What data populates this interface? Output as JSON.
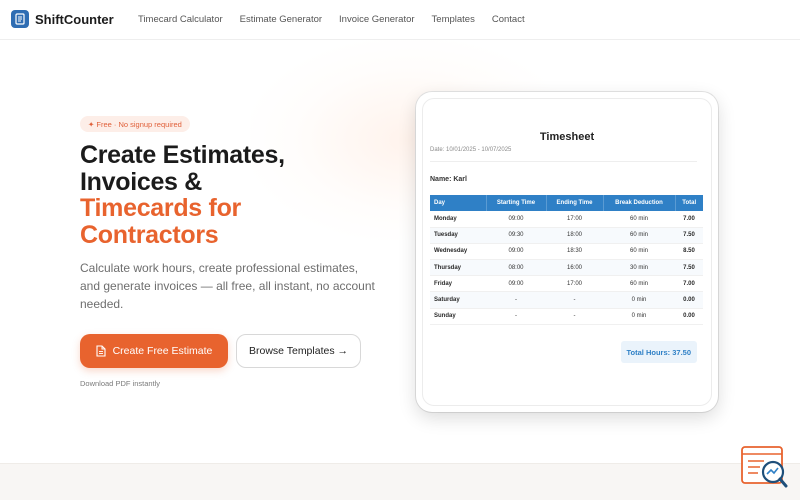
{
  "header": {
    "brand": "ShiftCounter",
    "nav": [
      "Timecard Calculator",
      "Estimate Generator",
      "Invoice Generator",
      "Templates",
      "Contact"
    ]
  },
  "hero": {
    "badge": "✦ Free · No signup required",
    "title_line1": "Create Estimates,",
    "title_line2": "Invoices &",
    "title_accent_line1": "Timecards for",
    "title_accent_line2": "Contractors",
    "subtitle": "Calculate work hours, create professional estimates, and generate invoices — all free, all instant, no account needed.",
    "primary_button": "Create Free Estimate",
    "secondary_button": "Browse Templates →",
    "hint": "Download PDF instantly"
  },
  "timesheet": {
    "title": "Timesheet",
    "date": "Date: 10/01/2025 - 10/07/2025",
    "name": "Name: Karl",
    "columns": [
      "Day",
      "Starting Time",
      "Ending Time",
      "Break Deduction",
      "Total"
    ],
    "rows": [
      [
        "Monday",
        "09:00",
        "17:00",
        "60 min",
        "7.00"
      ],
      [
        "Tuesday",
        "09:30",
        "18:00",
        "60 min",
        "7.50"
      ],
      [
        "Wednesday",
        "09:00",
        "18:30",
        "60 min",
        "8.50"
      ],
      [
        "Thursday",
        "08:00",
        "16:00",
        "30 min",
        "7.50"
      ],
      [
        "Friday",
        "09:00",
        "17:00",
        "60 min",
        "7.00"
      ],
      [
        "Saturday",
        "-",
        "-",
        "0 min",
        "0.00"
      ],
      [
        "Sunday",
        "-",
        "-",
        "0 min",
        "0.00"
      ]
    ],
    "total": "Total Hours: 37.50"
  },
  "colors": {
    "accent": "#e8632e",
    "table_header": "#2f80c6",
    "brand": "#2f6db3"
  },
  "icons": {
    "logo": "timesheet-logo-icon",
    "primary_button": "document-icon",
    "widget": "search-chart-icon"
  }
}
